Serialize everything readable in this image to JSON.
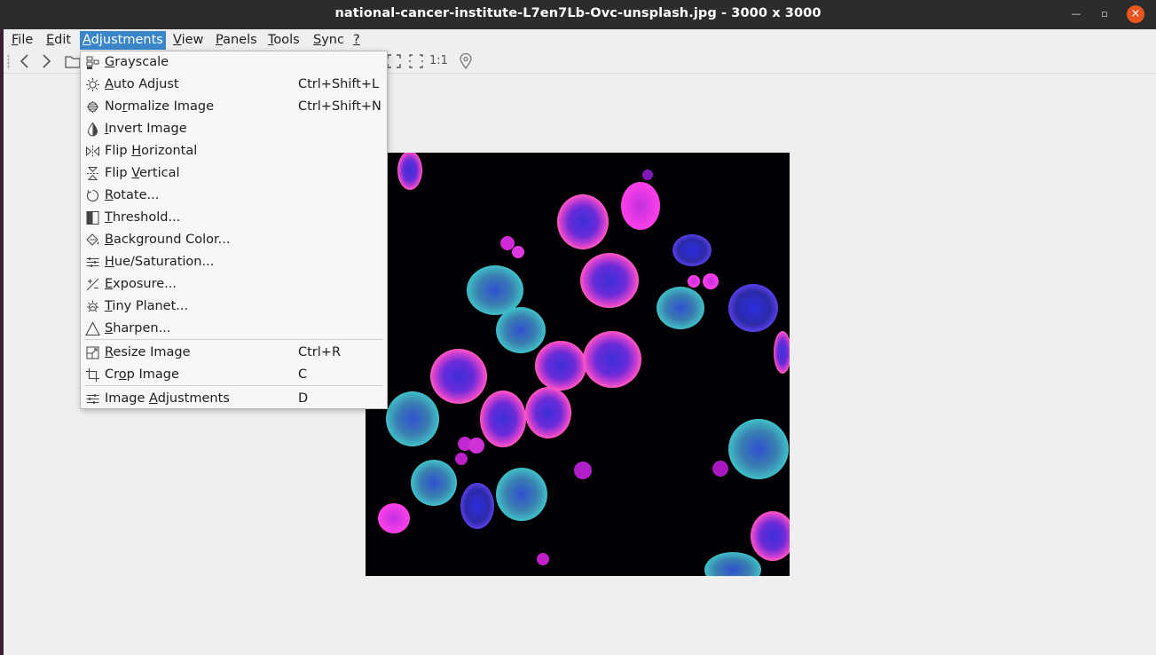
{
  "window": {
    "title": "national-cancer-institute-L7en7Lb-Ovc-unsplash.jpg  - 3000 x 3000",
    "minimize_glyph": "—",
    "maximize_glyph": "▫",
    "close_glyph": "×"
  },
  "menubar": [
    {
      "pre": "",
      "mnem": "F",
      "post": "ile"
    },
    {
      "pre": "",
      "mnem": "E",
      "post": "dit"
    },
    {
      "pre": "",
      "mnem": "A",
      "post": "djustments"
    },
    {
      "pre": "",
      "mnem": "V",
      "post": "iew"
    },
    {
      "pre": "",
      "mnem": "P",
      "post": "anels"
    },
    {
      "pre": "",
      "mnem": "T",
      "post": "ools"
    },
    {
      "pre": "",
      "mnem": "S",
      "post": "ync"
    },
    {
      "pre": "",
      "mnem": "?",
      "post": ""
    }
  ],
  "toolbar": {
    "back_glyph": "‹",
    "forward_glyph": "›",
    "actual_size_label": "1:1"
  },
  "adjustments_menu": [
    {
      "pre": "",
      "mnem": "G",
      "post": "rayscale",
      "shortcut": "",
      "icon": "grayscale-icon"
    },
    {
      "pre": "",
      "mnem": "A",
      "post": "uto Adjust",
      "shortcut": "Ctrl+Shift+L",
      "icon": "auto-adjust-icon"
    },
    {
      "pre": "No",
      "mnem": "r",
      "post": "malize Image",
      "shortcut": "Ctrl+Shift+N",
      "icon": "normalize-icon"
    },
    {
      "pre": "",
      "mnem": "I",
      "post": "nvert Image",
      "shortcut": "",
      "icon": "invert-icon"
    },
    {
      "pre": "Flip ",
      "mnem": "H",
      "post": "orizontal",
      "shortcut": "",
      "icon": "flip-horizontal-icon"
    },
    {
      "pre": "Flip ",
      "mnem": "V",
      "post": "ertical",
      "shortcut": "",
      "icon": "flip-vertical-icon"
    },
    {
      "pre": "",
      "mnem": "R",
      "post": "otate...",
      "shortcut": "",
      "icon": "rotate-icon"
    },
    {
      "pre": "",
      "mnem": "T",
      "post": "hreshold...",
      "shortcut": "",
      "icon": "threshold-icon"
    },
    {
      "pre": "",
      "mnem": "B",
      "post": "ackground Color...",
      "shortcut": "",
      "icon": "background-color-icon"
    },
    {
      "pre": "",
      "mnem": "H",
      "post": "ue/Saturation...",
      "shortcut": "",
      "icon": "hue-saturation-icon"
    },
    {
      "pre": "",
      "mnem": "E",
      "post": "xposure...",
      "shortcut": "",
      "icon": "exposure-icon"
    },
    {
      "pre": "",
      "mnem": "T",
      "post": "iny Planet...",
      "shortcut": "",
      "icon": "tiny-planet-icon"
    },
    {
      "pre": "",
      "mnem": "S",
      "post": "harpen...",
      "shortcut": "",
      "icon": "sharpen-icon"
    },
    {
      "pre": "",
      "mnem": "R",
      "post": "esize Image",
      "shortcut": "Ctrl+R",
      "icon": "resize-icon"
    },
    {
      "pre": "Cr",
      "mnem": "o",
      "post": "p Image",
      "shortcut": "C",
      "icon": "crop-icon"
    },
    {
      "pre": "Image ",
      "mnem": "A",
      "post": "djustments",
      "shortcut": "D",
      "icon": "image-adjustments-icon"
    }
  ],
  "colors": {
    "menu_highlight": "#3a86c8",
    "titlebar": "#2c2c2c",
    "close_button": "#e95420",
    "image_background": "#020004"
  }
}
